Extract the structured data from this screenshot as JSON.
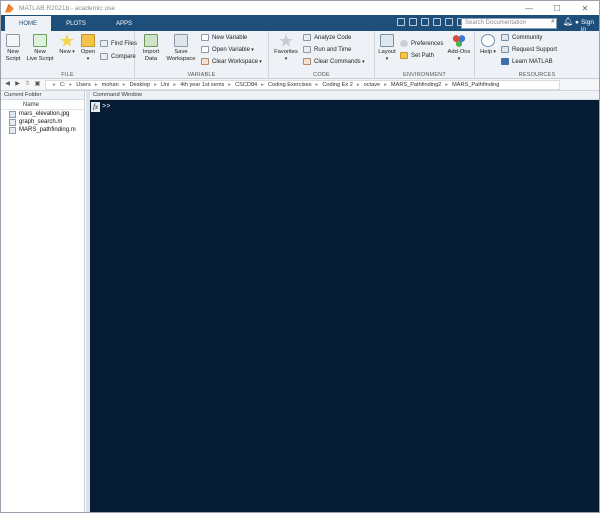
{
  "window": {
    "title": "MATLAB R2021b - academic use",
    "controls": [
      "—",
      "☐",
      "✕"
    ]
  },
  "tabs": [
    {
      "label": "HOME",
      "active": true
    },
    {
      "label": "PLOTS",
      "active": false
    },
    {
      "label": "APPS",
      "active": false
    }
  ],
  "search": {
    "placeholder": "Search Documentation"
  },
  "account": {
    "signin": "Sign in"
  },
  "ribbon": {
    "file": {
      "label": "FILE",
      "new_script": "New\nScript",
      "new_live_script": "New\nLive Script",
      "new": "New",
      "open": "Open",
      "find_files": "Find Files",
      "compare": "Compare"
    },
    "variable": {
      "label": "VARIABLE",
      "import_data": "Import\nData",
      "save_workspace": "Save\nWorkspace",
      "new_variable": "New Variable",
      "open_variable": "Open Variable",
      "clear_workspace": "Clear Workspace"
    },
    "code": {
      "label": "CODE",
      "favorites": "Favorites",
      "analyze_code": "Analyze Code",
      "run_and_time": "Run and Time",
      "clear_commands": "Clear Commands"
    },
    "environment": {
      "label": "ENVIRONMENT",
      "layout": "Layout",
      "preferences": "Preferences",
      "set_path": "Set Path",
      "add_ons": "Add-Ons"
    },
    "resources": {
      "label": "RESOURCES",
      "help": "Help",
      "community": "Community",
      "request_support": "Request Support",
      "learn_matlab": "Learn MATLAB"
    }
  },
  "address": {
    "crumbs": [
      "C:",
      "Users",
      "mohan",
      "Desktop",
      "Uni",
      "4th year 1st sems",
      "CSCD84",
      "Coding Exercises",
      "Coding Ex 2",
      "octave",
      "MARS_Pathfinding2",
      "MARS_Pathfinding"
    ]
  },
  "current_folder": {
    "title": "Current Folder",
    "column": "Name",
    "files": [
      "mars_elevation.jpg",
      "graph_search.m",
      "MARS_pathfinding.m"
    ]
  },
  "command_window": {
    "title": "Command Window",
    "fx": "fx",
    "prompt": ">>"
  },
  "colors": {
    "tab_strip": "#1e4f7a",
    "ribbon": "#eef2f6",
    "command_bg": "#051c33"
  }
}
